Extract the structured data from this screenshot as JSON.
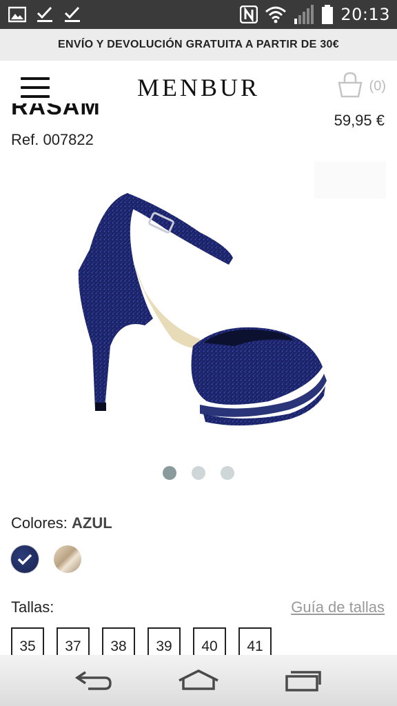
{
  "status_bar": {
    "time": "20:13",
    "left_icons": [
      "image-icon",
      "check-icon",
      "check-icon"
    ],
    "right_icons": [
      "nfc-icon",
      "wifi-icon",
      "signal-icon",
      "battery-icon"
    ]
  },
  "promo": {
    "text": "ENVÍO Y DEVOLUCIÓN GRATUITA A PARTIR DE 30€"
  },
  "header": {
    "logo": "MENBUR",
    "cart_count": "(0)"
  },
  "product": {
    "title_partial": "RASAM",
    "price": "59,95 €",
    "ref": "Ref. 007822",
    "image_count": 3,
    "active_image": 1
  },
  "colors": {
    "label": "Colores:",
    "selected": "AZUL",
    "swatches": [
      {
        "name": "azul",
        "color": "#1f2a5e",
        "selected": true
      },
      {
        "name": "beige",
        "color": "#c9b393",
        "selected": false
      }
    ]
  },
  "sizes": {
    "label": "Tallas:",
    "guide_link": "Guía de tallas",
    "options": [
      "35",
      "37",
      "38",
      "39",
      "40",
      "41"
    ]
  },
  "colors_theme": {
    "status_bar_bg": "#3a3a3a",
    "promo_bg": "#ececec",
    "dot_active": "#8a9a9d",
    "dot_inactive": "#cfd6d7"
  }
}
